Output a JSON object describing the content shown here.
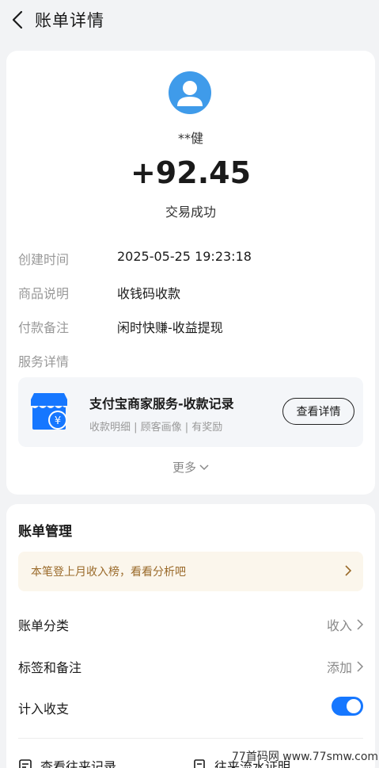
{
  "header": {
    "title": "账单详情"
  },
  "transaction": {
    "name": "**健",
    "amount": "+92.45",
    "status": "交易成功"
  },
  "details": {
    "created_label": "创建时间",
    "created_value": "2025-05-25 19:23:18",
    "product_label": "商品说明",
    "product_value": "收钱码收款",
    "remark_label": "付款备注",
    "remark_value": "闲时快赚-收益提现",
    "service_label": "服务详情"
  },
  "service": {
    "title": "支付宝商家服务-收款记录",
    "subtitle": "收款明细 | 顾客画像 | 有奖励",
    "button": "查看详情"
  },
  "more_label": "更多",
  "management": {
    "title": "账单管理",
    "banner": "本笔登上月收入榜，看看分析吧",
    "category_label": "账单分类",
    "category_value": "收入",
    "tags_label": "标签和备注",
    "tags_value": "添加",
    "income_label": "计入收支",
    "income_toggle_on": true,
    "link_history": "查看往来记录",
    "link_proof": "往来流水证明"
  },
  "watermark": "77首码网 www.77smw.com",
  "colors": {
    "accent": "#1677ff",
    "avatar": "#3f9bea",
    "banner_text": "#9a6a2a"
  }
}
